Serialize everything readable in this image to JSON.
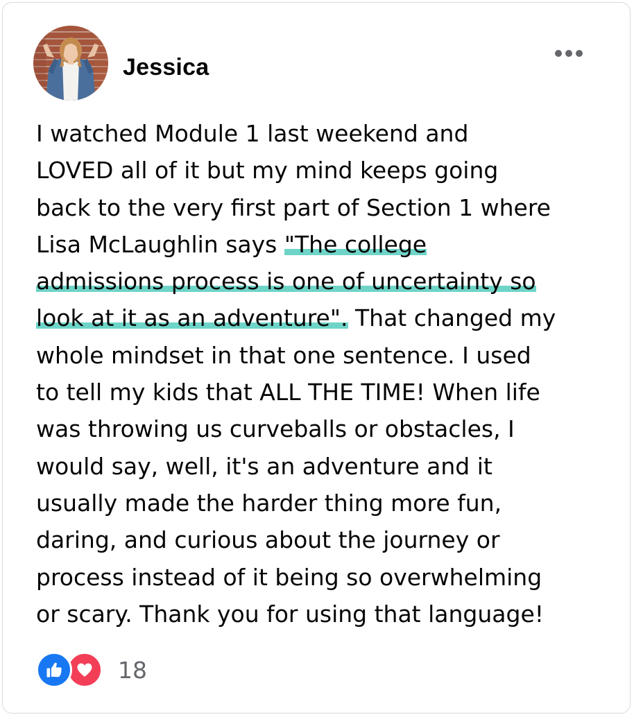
{
  "post": {
    "author": "Jessica",
    "avatar_icon": "profile-photo",
    "more_icon": "more-horizontal-icon",
    "body": {
      "line1": "I watched Module 1 last weekend and",
      "line2": "LOVED all of it but my mind keeps going",
      "line3": "back to the very first part of Section 1 where",
      "line4_pre": "Lisa McLaughlin says ",
      "line4_hl": "\"The college",
      "line5_hl": "admissions process is one of uncertainty so",
      "line6_hl": "look at it as an adventure\".",
      "line6_post": " That changed my",
      "line7": "whole mindset in that one sentence.  I used",
      "line8": "to tell my kids that ALL THE TIME! When life",
      "line9": "was throwing us curveballs or obstacles, I",
      "line10": "would say, well, it's an adventure and it",
      "line11": "usually made the harder thing more fun,",
      "line12": "daring, and curious about the journey or",
      "line13": "process instead of it being so overwhelming",
      "line14": "or scary.  Thank you for using that language!"
    },
    "highlight_color": "#6fd4c8",
    "reactions": {
      "icons": [
        "like-icon",
        "love-icon"
      ],
      "like_color": "#1877f2",
      "love_color": "#f33e58",
      "count": "18"
    }
  }
}
